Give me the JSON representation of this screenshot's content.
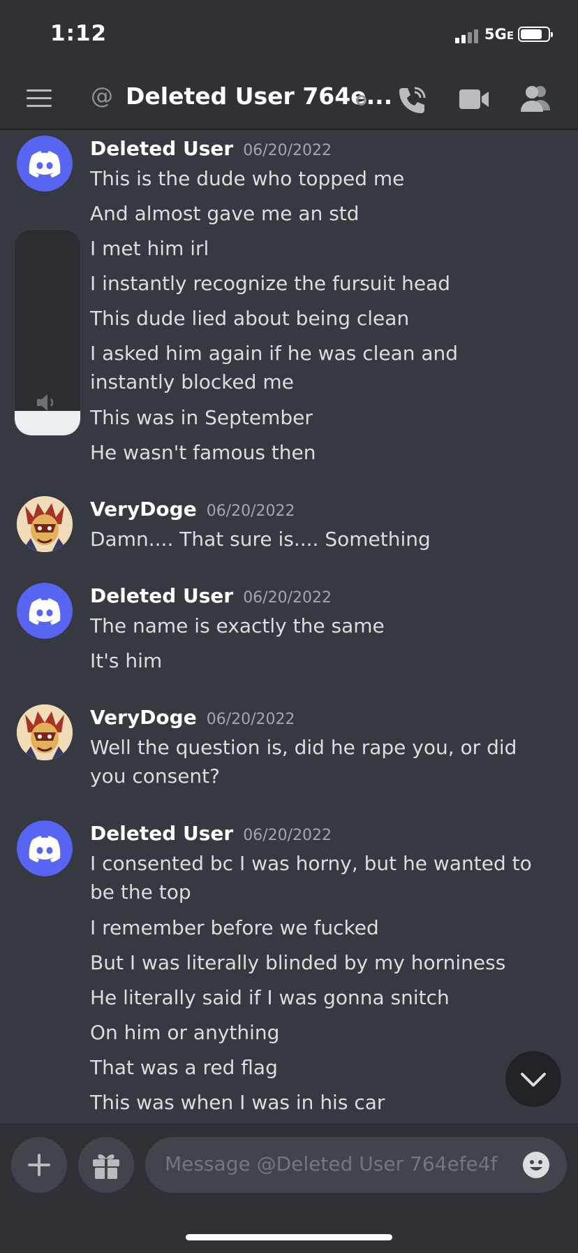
{
  "status_bar": {
    "time": "1:12",
    "network": "5G",
    "network_suffix": "E"
  },
  "header": {
    "at_symbol": "@",
    "title": "Deleted User 764e...",
    "icons": [
      "menu-icon",
      "call-icon",
      "video-icon",
      "members-icon"
    ]
  },
  "messages": [
    {
      "author": "Deleted User",
      "timestamp": "06/20/2022",
      "avatar": "discord-avatar",
      "lines": [
        "This is the dude who topped me",
        "And almost gave me an std",
        "I met him irl",
        "I instantly recognize the fursuit head",
        "This dude lied about being clean",
        "I asked him again if he was clean and instantly blocked me",
        "This was in September",
        "He wasn't famous then"
      ]
    },
    {
      "author": "VeryDoge",
      "timestamp": "06/20/2022",
      "avatar": "verydoge-avatar",
      "lines": [
        "Damn.... That sure is.... Something"
      ]
    },
    {
      "author": "Deleted User",
      "timestamp": "06/20/2022",
      "avatar": "discord-avatar",
      "lines": [
        "The name is exactly the same",
        "It's him"
      ]
    },
    {
      "author": "VeryDoge",
      "timestamp": "06/20/2022",
      "avatar": "verydoge-avatar",
      "lines": [
        "Well the question is, did he rape you, or did you consent?"
      ]
    },
    {
      "author": "Deleted User",
      "timestamp": "06/20/2022",
      "avatar": "discord-avatar",
      "lines": [
        "I consented bc I was horny, but he wanted to be the top",
        "I remember before we fucked",
        "But I was literally blinded by my horniness",
        "He literally said if I was gonna snitch",
        "On him or anything",
        "That was a red flag",
        "This was when I was in his car"
      ]
    }
  ],
  "volume_hud": {
    "level": 0.12
  },
  "composer": {
    "placeholder": "Message @Deleted User 764efe4f"
  },
  "colors": {
    "background": "#36393f",
    "header": "#2f3136",
    "blurple": "#5865f2",
    "text": "#dcddde",
    "muted": "#a3a6aa"
  }
}
